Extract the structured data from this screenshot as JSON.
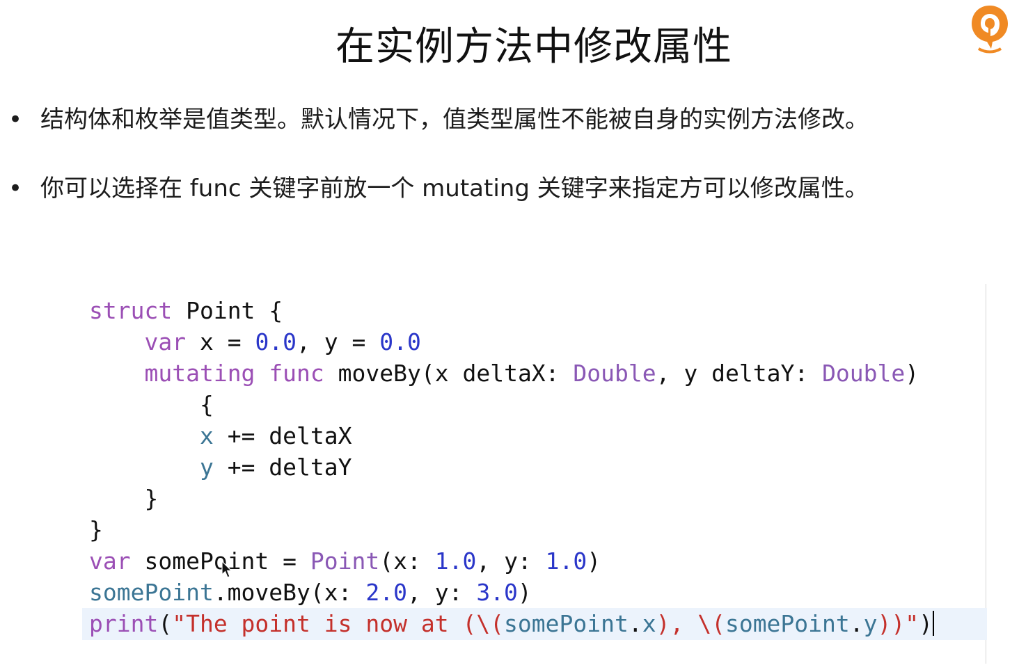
{
  "slide": {
    "title": "在实例方法中修改属性",
    "bullet_symbol": "•",
    "bullets": [
      "结构体和枚举是值类型。默认情况下，值类型属性不能被自身的实例方法修改。",
      "你可以选择在 func 关键字前放一个 mutating 关键字来指定方可以修改属性。"
    ]
  },
  "code": {
    "l1": {
      "k": "struct",
      "rest": " Point {"
    },
    "l2": {
      "ind": "    ",
      "k": "var",
      "a": " x = ",
      "n1": "0.0",
      "b": ", y = ",
      "n2": "0.0"
    },
    "l3": {
      "ind": "    ",
      "k1": "mutating",
      "sp": " ",
      "k2": "func",
      "a": " moveBy(x deltaX: ",
      "t1": "Double",
      "b": ", y deltaY: ",
      "t2": "Double",
      "c": ")"
    },
    "l4": {
      "text": "        {"
    },
    "l5": {
      "ind": "        ",
      "p": "x",
      "rest": " += deltaX"
    },
    "l6": {
      "ind": "        ",
      "p": "y",
      "rest": " += deltaY"
    },
    "l7": {
      "text": "    }"
    },
    "l8": {
      "text": "}"
    },
    "l9": {
      "k": "var",
      "a": " somePoint = ",
      "t": "Point",
      "b": "(x: ",
      "n1": "1.0",
      "c": ", y: ",
      "n2": "1.0",
      "d": ")"
    },
    "l10": {
      "p": "somePoint",
      "a": ".moveBy(x: ",
      "n1": "2.0",
      "b": ", y: ",
      "n2": "3.0",
      "c": ")"
    },
    "l11": {
      "f": "print",
      "a": "(",
      "s1": "\"The point is now at (\\(",
      "p1": "somePoint",
      "d1": ".",
      "p2": "x",
      "s2": "), \\(",
      "p3": "somePoint",
      "d2": ".",
      "p4": "y",
      "s3": "))\"",
      "c": ")"
    }
  },
  "colors": {
    "keyword": "#9b4fb5",
    "number": "#2a36c9",
    "type": "#8a58b5",
    "property": "#3b7594",
    "string": "#c4302b",
    "current_line": "#ecf3fc",
    "logo": "#f08a24"
  },
  "icons": {
    "logo": "brand-logo-icon",
    "cursor": "mouse-pointer-icon"
  }
}
